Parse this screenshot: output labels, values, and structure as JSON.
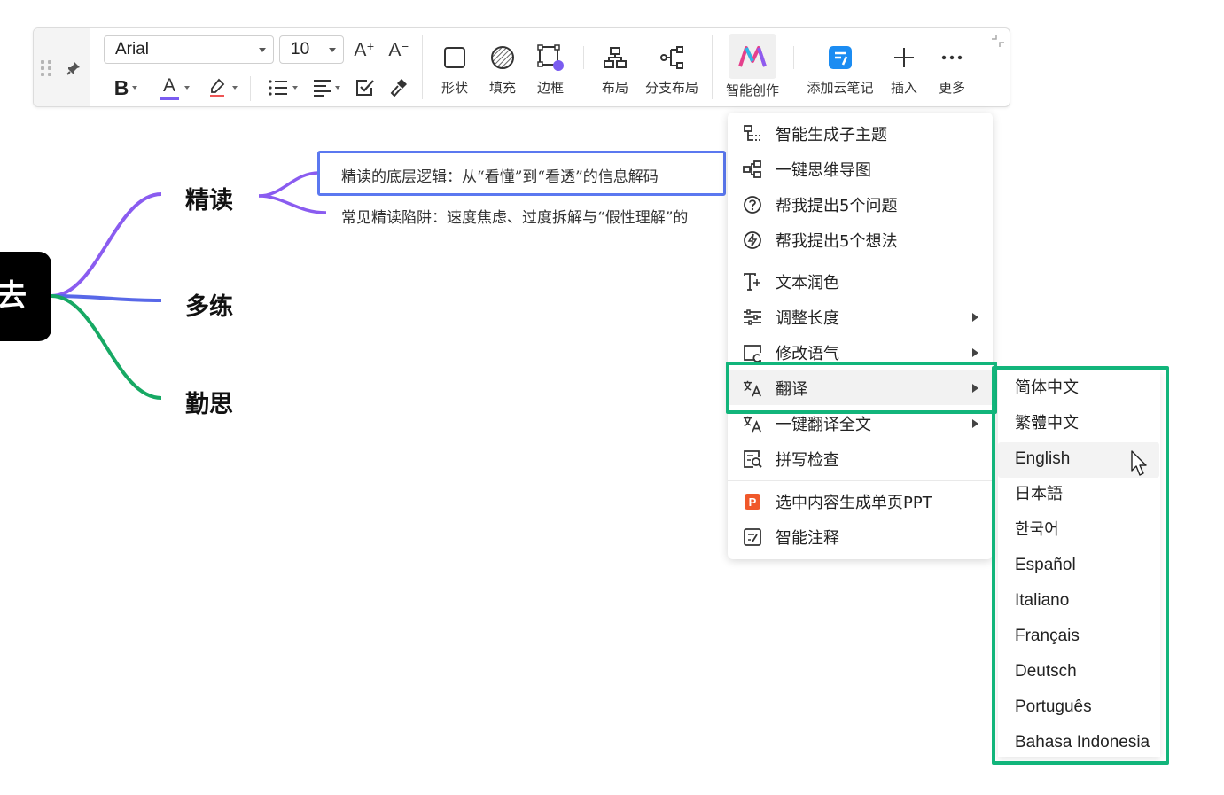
{
  "toolbar": {
    "font_family": "Arial",
    "font_size": "10",
    "increase_font_label": "A",
    "decrease_font_label": "A",
    "bold_label": "B",
    "font_color_label": "A",
    "buttons": {
      "shape": "形状",
      "fill": "填充",
      "border": "边框",
      "layout": "布局",
      "branch_layout": "分支布局",
      "ai_create": "智能创作",
      "add_cloud_note": "添加云笔记",
      "insert": "插入",
      "more": "更多"
    },
    "accent_color": "#7a5cf0"
  },
  "mindmap": {
    "root_label": "去",
    "branches": [
      "精读",
      "多练",
      "勤思"
    ],
    "leaves": [
      "精读的底层逻辑：从“看懂”到“看透”的信息解码",
      "常见精读陷阱：速度焦虑、过度拆解与“假性理解”的"
    ],
    "colors": {
      "branch1": "#8a5cf0",
      "branch2": "#5868e8",
      "branch3": "#17a964",
      "selection": "#5b78f0"
    }
  },
  "menu": {
    "items": [
      {
        "label": "智能生成子主题",
        "icon": "subtopic-icon"
      },
      {
        "label": "一键思维导图",
        "icon": "mindmap-icon"
      },
      {
        "label": "帮我提出5个问题",
        "icon": "question-icon"
      },
      {
        "label": "帮我提出5个想法",
        "icon": "idea-icon"
      },
      {
        "label": "文本润色",
        "icon": "text-polish-icon"
      },
      {
        "label": "调整长度",
        "icon": "adjust-length-icon"
      },
      {
        "label": "修改语气",
        "icon": "tone-icon"
      },
      {
        "label": "翻译",
        "icon": "translate-icon"
      },
      {
        "label": "一键翻译全文",
        "icon": "translate-all-icon"
      },
      {
        "label": "拼写检查",
        "icon": "spell-check-icon"
      },
      {
        "label": "选中内容生成单页PPT",
        "icon": "ppt-icon"
      },
      {
        "label": "智能注释",
        "icon": "annotation-icon"
      }
    ],
    "highlight_color": "#12b57b"
  },
  "submenu": {
    "languages": [
      "简体中文",
      "繁體中文",
      "English",
      "日本語",
      "한국어",
      "Español",
      "Italiano",
      "Français",
      "Deutsch",
      "Português",
      "Bahasa Indonesia"
    ]
  }
}
